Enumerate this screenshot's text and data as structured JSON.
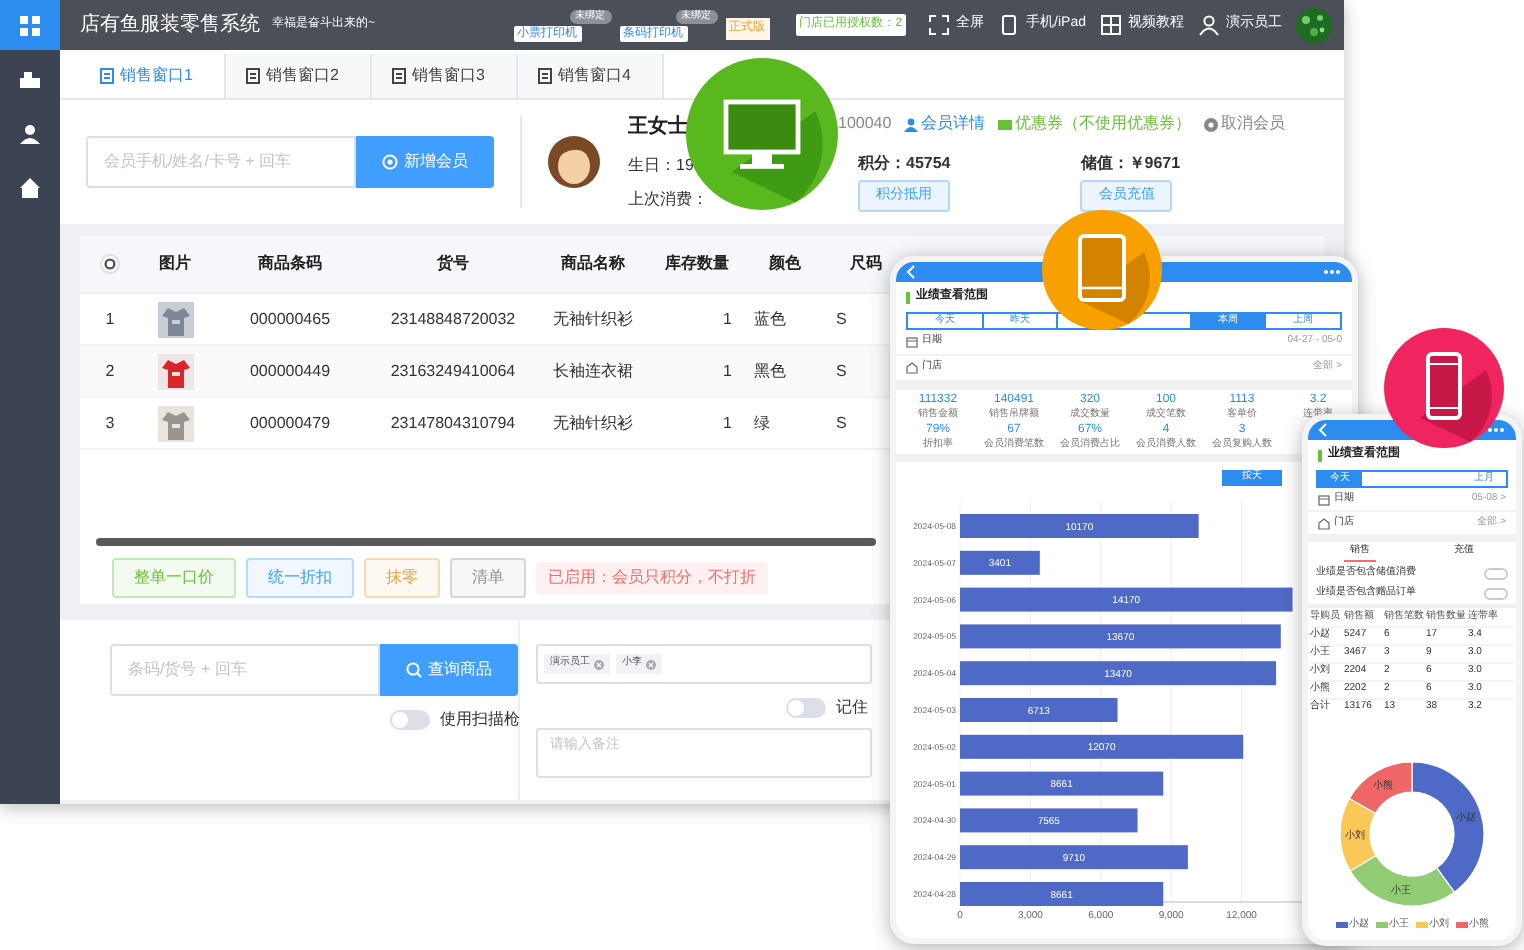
{
  "sidebar": {
    "items": [
      {
        "selected": true
      },
      {
        "selected": false
      },
      {
        "selected": false
      },
      {
        "selected": false
      }
    ]
  },
  "header": {
    "title": "店有鱼服装零售系统",
    "slogan": "幸福是奋斗出来的~",
    "printers": [
      {
        "label": "小票打印机",
        "status": "未绑定"
      },
      {
        "label": "条码打印机",
        "status": "未绑定"
      }
    ],
    "edition": "正式版",
    "license": "门店已用授权数：2",
    "actions": [
      "全屏",
      "手机/iPad",
      "视频教程",
      "演示员工"
    ]
  },
  "tabs": [
    {
      "label": "销售窗口1",
      "selected": true
    },
    {
      "label": "销售窗口2",
      "selected": false
    },
    {
      "label": "销售窗口3",
      "selected": false
    },
    {
      "label": "销售窗口4",
      "selected": false
    }
  ],
  "member_search": {
    "placeholder": "会员手机/姓名/卡号 + 回车",
    "button": "新增会员"
  },
  "member": {
    "name": "王女士",
    "birthday": "生日：19",
    "last_purchase": "上次消费：",
    "card_no": "100040",
    "details_link": "会员详情",
    "coupon": "优惠券（不使用优惠券）",
    "cancel": "取消会员",
    "points": "积分：45754",
    "points_button": "积分抵用",
    "balance": "储值：￥9671",
    "recharge_button": "会员充值"
  },
  "table": {
    "columns": [
      "图片",
      "商品条码",
      "货号",
      "商品名称",
      "库存数量",
      "颜色",
      "尺码"
    ],
    "rows": [
      {
        "no": "1",
        "barcode": "000000465",
        "sku": "23148848720032",
        "name": "无袖针织衫",
        "stock": "1",
        "color_label": "蓝色",
        "size": "S"
      },
      {
        "no": "2",
        "barcode": "000000449",
        "sku": "23163249410064",
        "name": "长袖连衣裙",
        "stock": "1",
        "color_label": "黑色",
        "size": "S"
      },
      {
        "no": "3",
        "barcode": "000000479",
        "sku": "23147804310794",
        "name": "无袖针织衫",
        "stock": "1",
        "color_label": "绿",
        "size": "S"
      }
    ]
  },
  "order_buttons": [
    {
      "label": "整单一口价",
      "color": "#67c23a"
    },
    {
      "label": "统一折扣",
      "color": "#409eff"
    },
    {
      "label": "抹零",
      "color": "#e6a23c"
    },
    {
      "label": "清单",
      "color": "#909399"
    }
  ],
  "notice": "已启用：会员只积分，不打折",
  "product_search": {
    "placeholder": "条码/货号 + 回车",
    "button": "查询商品",
    "scanner_toggle": {
      "label": "使用扫描枪",
      "on": false
    }
  },
  "staff": {
    "tags": [
      "演示员工",
      "小李"
    ],
    "remember_toggle": {
      "label": "记住",
      "on": false
    },
    "note_placeholder": "请输入备注"
  },
  "tablet": {
    "title": "业绩查看范围",
    "tabs": [
      {
        "label": "今天",
        "selected": false
      },
      {
        "label": "昨天",
        "selected": false
      },
      {
        "label": "本周",
        "selected": true
      },
      {
        "label": "上周",
        "selected": false
      }
    ],
    "date": {
      "label": "日期",
      "value": "04-27 - 05-0"
    },
    "store": {
      "label": "门店",
      "value": "全部 >"
    },
    "stats": [
      {
        "value": "111332",
        "label": "销售金额"
      },
      {
        "value": "140491",
        "label": "销售吊牌额"
      },
      {
        "value": "320",
        "label": "成交数量"
      },
      {
        "value": "100",
        "label": "成交笔数"
      },
      {
        "value": "1113",
        "label": "客单价"
      },
      {
        "value": "3.2",
        "label": "连带率"
      }
    ],
    "stats_2": [
      {
        "value": "79%",
        "label": "折扣率"
      },
      {
        "value": "67",
        "label": "会员消费笔数"
      },
      {
        "value": "67%",
        "label": "会员消费占比"
      },
      {
        "value": "4",
        "label": "会员消费人数"
      },
      {
        "value": "3",
        "label": "会员复购人数"
      }
    ],
    "group_button": {
      "label": "按天",
      "selected": true
    },
    "chart_data": {
      "type": "bar",
      "orientation": "horizontal",
      "categories": [
        "2024-05-08",
        "2024-05-07",
        "2024-05-06",
        "2024-05-05",
        "2024-05-04",
        "2024-05-03",
        "2024-05-02",
        "2024-05-01",
        "2024-04-30",
        "2024-04-29",
        "2024-04-28"
      ],
      "values": [
        10170,
        3401,
        14170,
        13670,
        13470,
        6713,
        12070,
        8661,
        7565,
        9710,
        8661
      ],
      "xlim": [
        0,
        15000
      ],
      "xticks": [
        0,
        {
          "value": 3000,
          "label": "3,000"
        },
        {
          "value": 6000,
          "label": "6,000"
        },
        {
          "value": 9000,
          "label": "9,000"
        },
        {
          "value": 12000,
          "label": "12,000"
        }
      ],
      "grid": true,
      "data_labels": true
    }
  },
  "phone": {
    "title": "业绩查看范围",
    "tabs": [
      {
        "label": "今天",
        "selected": true
      },
      {
        "label": "上月",
        "selected": false
      }
    ],
    "date": {
      "label": "日期",
      "value": "05-08 >"
    },
    "store": {
      "label": "门店",
      "value": "全部 >"
    },
    "subtabs": [
      {
        "label": "销售",
        "selected": true
      },
      {
        "label": "充值",
        "selected": false
      }
    ],
    "toggles": [
      {
        "label": "业绩是否包含储值消费",
        "on": false
      },
      {
        "label": "业绩是否包含赠品订单",
        "on": false
      }
    ],
    "table": {
      "columns": [
        "导购员",
        "销售额",
        "销售笔数",
        "销售数量",
        "连带率"
      ],
      "rows": [
        [
          "小赵",
          "5247",
          "6",
          "17",
          "3.4"
        ],
        [
          "小王",
          "3467",
          "3",
          "9",
          "3.0"
        ],
        [
          "小刘",
          "2204",
          "2",
          "6",
          "3.0"
        ],
        [
          "小熊",
          "2202",
          "2",
          "6",
          "3.0"
        ],
        [
          "合计",
          "13176",
          "13",
          "38",
          "3.2"
        ]
      ]
    },
    "donut_labels": [
      "小赵",
      "小王",
      "小刘",
      "小熊"
    ],
    "legend": [
      "小赵",
      "小王",
      "小刘",
      "小熊"
    ]
  }
}
